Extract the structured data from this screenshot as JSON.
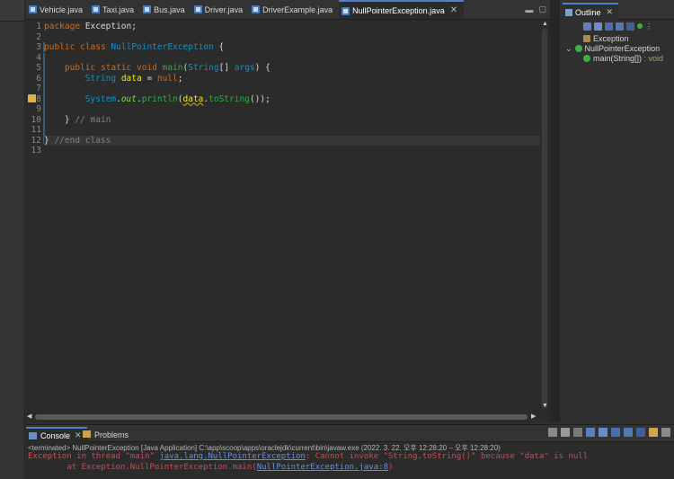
{
  "editor": {
    "tabs": [
      {
        "label": "Vehicle.java",
        "active": false
      },
      {
        "label": "Taxi.java",
        "active": false
      },
      {
        "label": "Bus.java",
        "active": false
      },
      {
        "label": "Driver.java",
        "active": false
      },
      {
        "label": "DriverExample.java",
        "active": false
      },
      {
        "label": "NullPointerException.java",
        "active": true
      }
    ],
    "close_glyph": "✕",
    "line_numbers": [
      "1",
      "2",
      "3",
      "4",
      "5",
      "6",
      "7",
      "8",
      "9",
      "10",
      "11",
      "12",
      "13"
    ],
    "code": {
      "l1_kw": "package",
      "l1_rest": " Exception;",
      "l3_kw1": "public",
      "l3_kw2": "class",
      "l3_cls": "NullPointerException",
      "l3_rest": " {",
      "l5_kw1": "public",
      "l5_kw2": "static",
      "l5_kw3": "void",
      "l5_mth": "main",
      "l5_p1": "(",
      "l5_type": "String",
      "l5_p2": "[] ",
      "l5_args": "args",
      "l5_p3": ") {",
      "l6_type": "String",
      "l6_var": "data",
      "l6_p1": " = ",
      "l6_null": "null",
      "l6_p2": ";",
      "l8_cls": "System",
      "l8_dot1": ".",
      "l8_out": "out",
      "l8_dot2": ".",
      "l8_println": "println",
      "l8_p1": "(",
      "l8_data": "data",
      "l8_dot3": ".",
      "l8_tostring": "toString",
      "l8_p2": "());",
      "l10_brace": "} ",
      "l10_comment": "// main",
      "l12_brace": "} ",
      "l12_comment": "//end class"
    }
  },
  "outline": {
    "tab_label": "Outline",
    "items": [
      {
        "label": "Exception",
        "icon": "package-icon"
      },
      {
        "label": "NullPointerException",
        "icon": "class-icon",
        "expanded": true
      },
      {
        "label": "main(String[])",
        "return": " : void",
        "icon": "method-icon"
      }
    ]
  },
  "console": {
    "tabs": [
      {
        "label": "Console",
        "active": true
      },
      {
        "label": "Problems",
        "active": false
      }
    ],
    "status": "<terminated> NullPointerException [Java Application] C:\\app\\scoop\\apps\\oraclejdk\\current\\bin\\javaw.exe  (2022. 3. 22. 오후 12:28:20 – 오후 12:28:20)",
    "line1_prefix": "Exception in thread \"main\" ",
    "line1_link": "java.lang.NullPointerException",
    "line1_suffix": ": Cannot invoke \"String.toString()\" because \"data\" is null",
    "line2_prefix": "\tat Exception.NullPointerException.main(",
    "line2_link": "NullPointerException.java:8",
    "line2_suffix": ")"
  },
  "colors": {
    "keyword": "#cc6c1d",
    "class": "#1290c3",
    "variable": "#f2f200",
    "field": "#8dda48",
    "comment": "#808080",
    "error_text": "#e0424a",
    "link": "#5c93e6"
  }
}
